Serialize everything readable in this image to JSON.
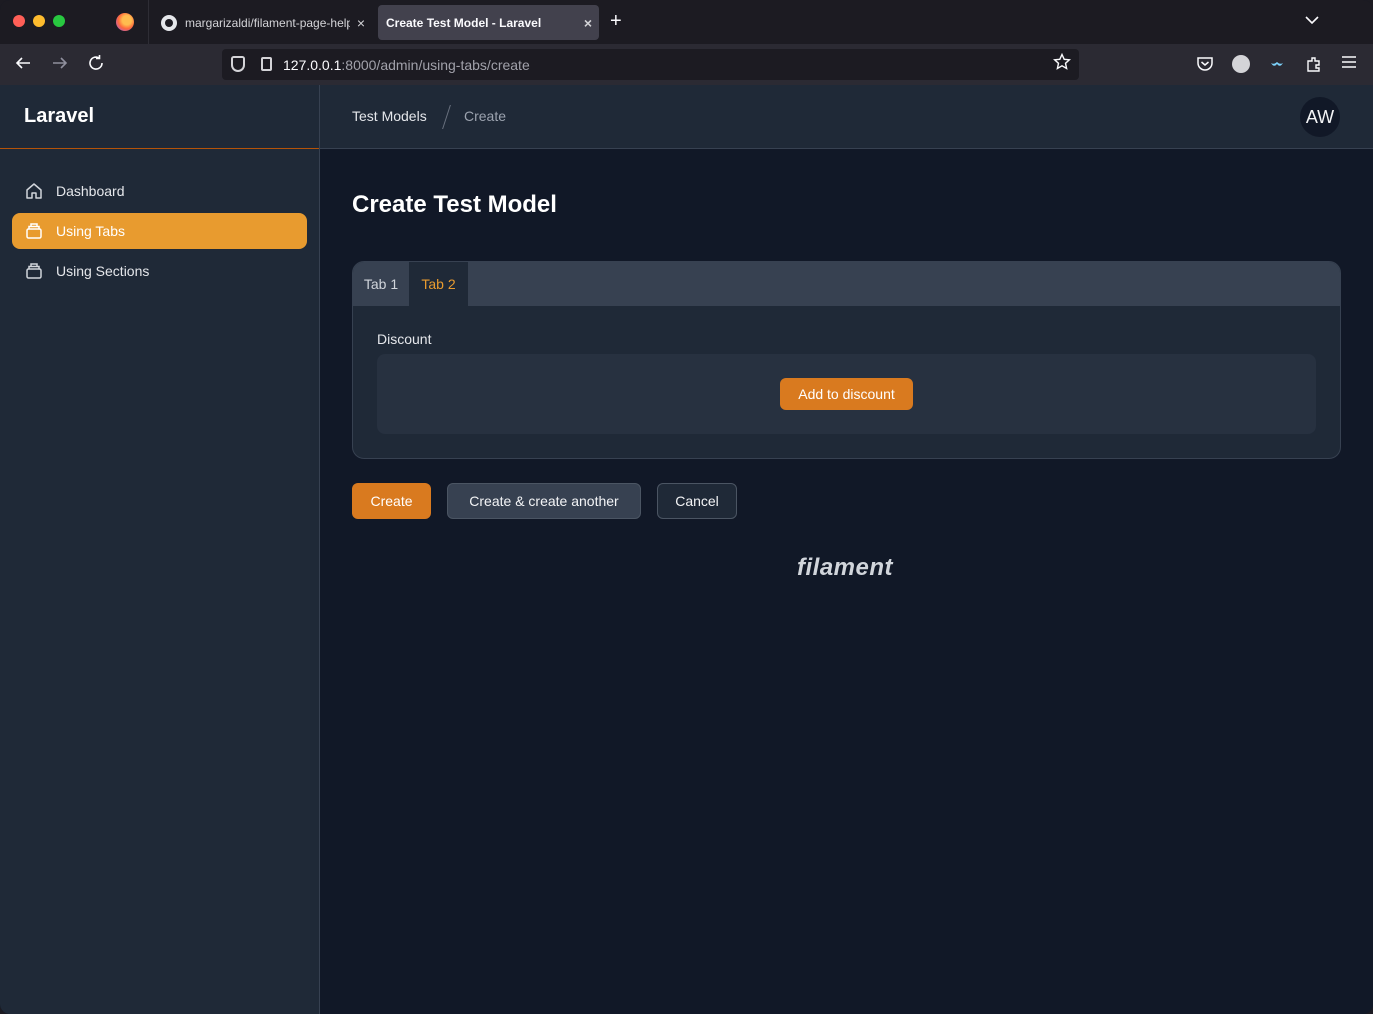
{
  "browser": {
    "tabs": [
      {
        "title": "margarizaldi/filament-page-help",
        "active": false
      },
      {
        "title": "Create Test Model - Laravel",
        "active": true
      }
    ],
    "close_glyph": "×",
    "new_tab_glyph": "+",
    "url": {
      "host": "127.0.0.1",
      "rest": ":8000/admin/using-tabs/create"
    }
  },
  "sidebar": {
    "brand": "Laravel",
    "items": [
      {
        "label": "Dashboard",
        "icon": "home-icon",
        "active": false
      },
      {
        "label": "Using Tabs",
        "icon": "collection-icon",
        "active": true
      },
      {
        "label": "Using Sections",
        "icon": "collection-icon",
        "active": false
      }
    ]
  },
  "topbar": {
    "breadcrumbs": [
      "Test Models",
      "Create"
    ],
    "avatar_initials": "AW"
  },
  "main": {
    "title": "Create Test Model",
    "tabs": [
      {
        "label": "Tab 1",
        "active": false
      },
      {
        "label": "Tab 2",
        "active": true
      }
    ],
    "field_label": "Discount",
    "add_button": "Add to discount",
    "actions": {
      "create": "Create",
      "create_another": "Create & create another",
      "cancel": "Cancel"
    },
    "footer_logo": "filament"
  },
  "colors": {
    "accent": "#e89b2f",
    "button": "#d97a1f",
    "background": "#111827",
    "panel": "#1f2937"
  }
}
